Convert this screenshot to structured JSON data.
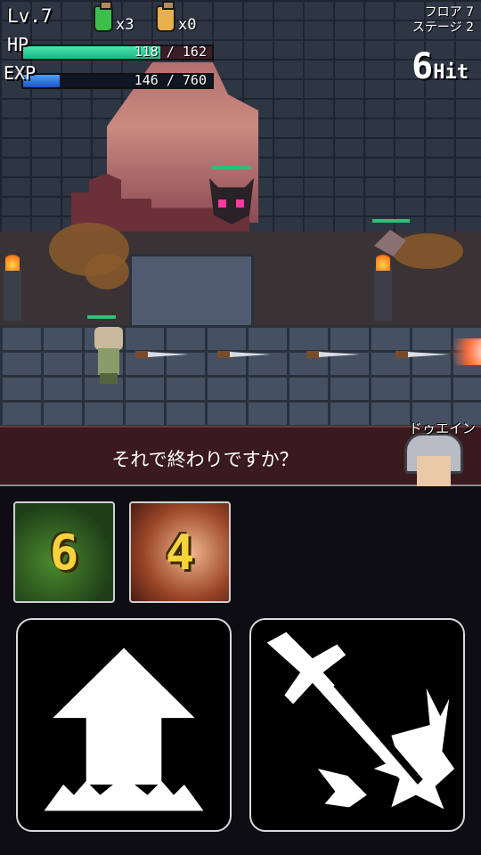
{
  "hud": {
    "level": "Lv.7",
    "potions": [
      {
        "name": "green-potion",
        "count": "x3",
        "color": "#3bbf4a"
      },
      {
        "name": "yellow-potion",
        "count": "x0",
        "color": "#e8b04a"
      }
    ],
    "hp_label": "HP",
    "hp_value": "118 / 162",
    "hp_fraction": 0.728,
    "exp_label": "EXP",
    "exp_value": "146 / 760",
    "exp_fraction": 0.192,
    "floor": "フロア 7",
    "stage": "ステージ 2",
    "combo_count": "6",
    "combo_unit": "Hit"
  },
  "dialog": {
    "text": "それで終わりですか？",
    "speaker": "ドゥエイン"
  },
  "skills": [
    {
      "name": "skill-green",
      "value": "6"
    },
    {
      "name": "skill-fire",
      "value": "4"
    }
  ],
  "controls": {
    "jump_icon": "up-arrow-icon",
    "attack_icon": "sword-strike-icon"
  },
  "colors": {
    "hp": "#17b684",
    "exp": "#1b55c8",
    "skill_number": "#f4d33c",
    "dialog_bg": "#3a1a1e"
  }
}
